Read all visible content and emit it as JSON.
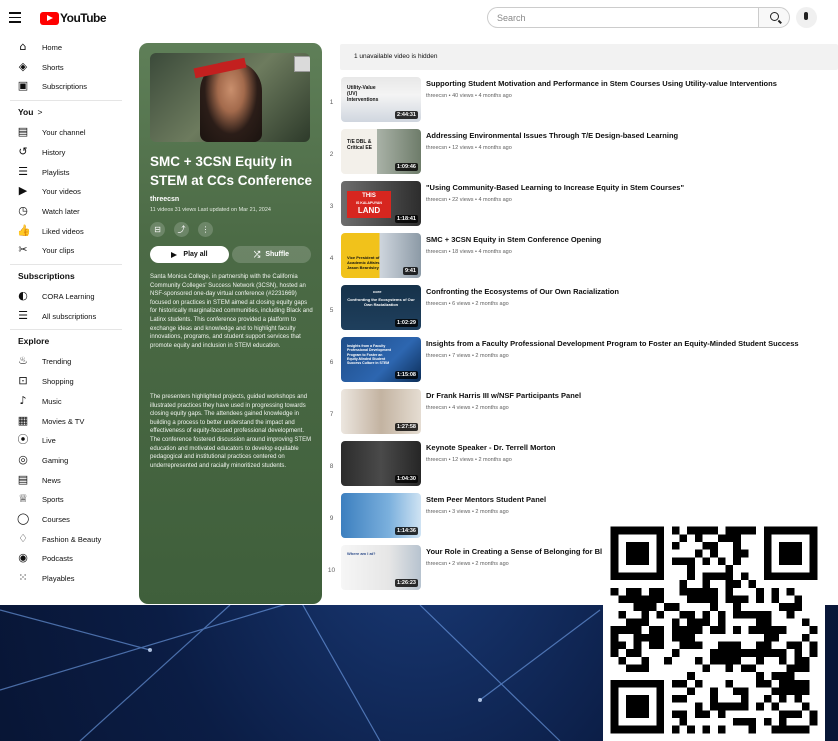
{
  "header": {
    "logo_text": "YouTube",
    "search_placeholder": "Search"
  },
  "sidebar": {
    "main": [
      {
        "label": "Home",
        "icon": "home-icon",
        "glyph": "⌂"
      },
      {
        "label": "Shorts",
        "icon": "shorts-icon",
        "glyph": "◈"
      },
      {
        "label": "Subscriptions",
        "icon": "subscriptions-icon",
        "glyph": "▣"
      }
    ],
    "you_heading": "You",
    "you_chevron": ">",
    "you": [
      {
        "label": "Your channel",
        "icon": "your-channel-icon",
        "glyph": "▤"
      },
      {
        "label": "History",
        "icon": "history-icon",
        "glyph": "↺"
      },
      {
        "label": "Playlists",
        "icon": "playlists-icon",
        "glyph": "☰"
      },
      {
        "label": "Your videos",
        "icon": "your-videos-icon",
        "glyph": "▶"
      },
      {
        "label": "Watch later",
        "icon": "watch-later-icon",
        "glyph": "◷"
      },
      {
        "label": "Liked videos",
        "icon": "liked-videos-icon",
        "glyph": "👍"
      },
      {
        "label": "Your clips",
        "icon": "your-clips-icon",
        "glyph": "✂"
      }
    ],
    "subscriptions_heading": "Subscriptions",
    "subscriptions": [
      {
        "label": "CORA Learning",
        "icon": "cora-learning-avatar",
        "glyph": "◐"
      },
      {
        "label": "All subscriptions",
        "icon": "list-icon",
        "glyph": "☰"
      }
    ],
    "explore_heading": "Explore",
    "explore": [
      {
        "label": "Trending",
        "icon": "trending-icon",
        "glyph": "♨"
      },
      {
        "label": "Shopping",
        "icon": "shopping-icon",
        "glyph": "⊡"
      },
      {
        "label": "Music",
        "icon": "music-icon",
        "glyph": "♪"
      },
      {
        "label": "Movies & TV",
        "icon": "movies-icon",
        "glyph": "▦"
      },
      {
        "label": "Live",
        "icon": "live-icon",
        "glyph": "⦿"
      },
      {
        "label": "Gaming",
        "icon": "gaming-icon",
        "glyph": "◎"
      },
      {
        "label": "News",
        "icon": "news-icon",
        "glyph": "▤"
      },
      {
        "label": "Sports",
        "icon": "sports-icon",
        "glyph": "♕"
      },
      {
        "label": "Courses",
        "icon": "courses-icon",
        "glyph": "◯"
      },
      {
        "label": "Fashion & Beauty",
        "icon": "fashion-icon",
        "glyph": "♢"
      },
      {
        "label": "Podcasts",
        "icon": "podcasts-icon",
        "glyph": "◉"
      },
      {
        "label": "Playables",
        "icon": "playables-icon",
        "glyph": "⁙"
      }
    ]
  },
  "playlist": {
    "title": "SMC + 3CSN Equity in STEM at CCs Conference",
    "owner": "threecsn",
    "meta": "11 videos  31 views  Last updated on Mar 21, 2024",
    "play_all": "Play all",
    "shuffle": "Shuffle",
    "description_1": "Santa Monica College, in partnership with the California Community Colleges' Success Network (3CSN),  hosted an NSF-sponsored one-day virtual conference (#2231669) focused on practices in STEM aimed at closing equity gaps for historically marginalized communities, including Black and Latinx students. This conference provided a platform to exchange ideas and knowledge and to highlight faculty innovations, programs, and student support services that promote equity and inclusion in STEM education.",
    "description_2": "The presenters highlighted projects, guided workshops and illustrated practices they have used in progressing towards closing equity gaps. The attendees gained knowledge in building a process to better understand the impact and effectiveness of equity-focused professional development. The conference fostered discussion around improving STEM education and motivated educators to develop equitable pedagogical and institutional practices centered on underrepresented and racially minoritized students."
  },
  "unavailable_notice": "1 unavailable video is hidden",
  "videos": [
    {
      "num": "1",
      "title": "Supporting Student Motivation and Performance in Stem Courses Using Utility-value Interventions",
      "meta": "threecsn • 40 views • 4 months ago",
      "duration": "2:44:31"
    },
    {
      "num": "2",
      "title": "Addressing Environmental Issues Through T/E Design-based Learning",
      "meta": "threecsn • 12 views • 4 months ago",
      "duration": "1:09:46"
    },
    {
      "num": "3",
      "title": "\"Using Community-Based Learning to Increase Equity in Stem Courses\"",
      "meta": "threecsn • 22 views • 4 months ago",
      "duration": "1:18:41"
    },
    {
      "num": "4",
      "title": "SMC + 3CSN Equity in Stem Conference Opening",
      "meta": "threecsn • 18 views • 4 months ago",
      "duration": "9:41"
    },
    {
      "num": "5",
      "title": "Confronting the Ecosystems of Our Own Racialization",
      "meta": "threecsn • 6 views • 2 months ago",
      "duration": "1:02:29"
    },
    {
      "num": "6",
      "title": "Insights from a Faculty Professional Development Program to Foster an Equity-Minded Student Success",
      "meta": "threecsn • 7 views • 2 months ago",
      "duration": "1:15:08"
    },
    {
      "num": "7",
      "title": "Dr Frank Harris III w/NSF Participants Panel",
      "meta": "threecsn • 4 views • 2 months ago",
      "duration": "1:27:58"
    },
    {
      "num": "8",
      "title": "Keynote Speaker - Dr. Terrell Morton",
      "meta": "threecsn • 12 views • 2 months ago",
      "duration": "1:04:30"
    },
    {
      "num": "9",
      "title": "Stem Peer Mentors Student Panel",
      "meta": "threecsn • 3 views • 2 months ago",
      "duration": "1:14:36"
    },
    {
      "num": "10",
      "title": "Your Role in Creating a Sense of Belonging for Bl",
      "meta": "threecsn • 2 views • 2 months ago",
      "duration": "1:26:23"
    }
  ],
  "thumb_text": {
    "t1": "Utility-Value (UV) Interventions",
    "t2": "T/E DBL & Critical EE",
    "t3_a": "THIS",
    "t3_b": "IS KALAPUYAN",
    "t3_c": "LAND",
    "t4": "Vice President of Academic Affairs Jason Beardsley",
    "t5_a": "core",
    "t5_b": "Confronting the Ecosystems of Our Own Racialization",
    "t6": "Insights from a Faculty Professional Development Program to Foster an Equity-Minded Student Success Culture in STEM",
    "t10": "Where am I at?"
  },
  "colors": {
    "brand_red": "#ff0000",
    "panel_green": "#4c6b46"
  }
}
